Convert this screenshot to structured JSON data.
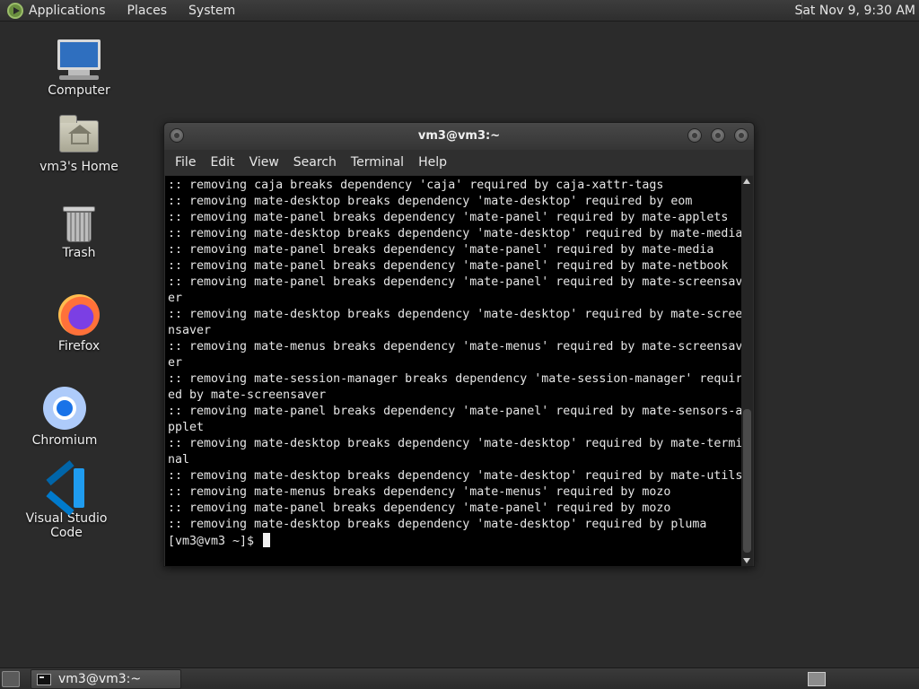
{
  "top_panel": {
    "menus": [
      "Applications",
      "Places",
      "System"
    ],
    "clock": "Sat Nov  9,  9:30 AM"
  },
  "desktop_icons": [
    {
      "label": "Computer",
      "icon": "computer-icon"
    },
    {
      "label": "vm3's Home",
      "icon": "home-folder-icon"
    },
    {
      "label": "Trash",
      "icon": "trash-icon"
    },
    {
      "label": "Firefox",
      "icon": "firefox-icon"
    },
    {
      "label": "Chromium",
      "icon": "chromium-icon"
    },
    {
      "label": "Visual Studio Code",
      "icon": "vscode-icon"
    }
  ],
  "terminal": {
    "title": "vm3@vm3:~",
    "menu": [
      "File",
      "Edit",
      "View",
      "Search",
      "Terminal",
      "Help"
    ],
    "lines": [
      ":: removing caja breaks dependency 'caja' required by caja-xattr-tags",
      ":: removing mate-desktop breaks dependency 'mate-desktop' required by eom",
      ":: removing mate-panel breaks dependency 'mate-panel' required by mate-applets",
      ":: removing mate-desktop breaks dependency 'mate-desktop' required by mate-media",
      ":: removing mate-panel breaks dependency 'mate-panel' required by mate-media",
      ":: removing mate-panel breaks dependency 'mate-panel' required by mate-netbook",
      ":: removing mate-panel breaks dependency 'mate-panel' required by mate-screensav",
      "er",
      ":: removing mate-desktop breaks dependency 'mate-desktop' required by mate-scree",
      "nsaver",
      ":: removing mate-menus breaks dependency 'mate-menus' required by mate-screensav",
      "er",
      ":: removing mate-session-manager breaks dependency 'mate-session-manager' requir",
      "ed by mate-screensaver",
      ":: removing mate-panel breaks dependency 'mate-panel' required by mate-sensors-a",
      "pplet",
      ":: removing mate-desktop breaks dependency 'mate-desktop' required by mate-termi",
      "nal",
      ":: removing mate-desktop breaks dependency 'mate-desktop' required by mate-utils",
      ":: removing mate-menus breaks dependency 'mate-menus' required by mozo",
      ":: removing mate-panel breaks dependency 'mate-panel' required by mozo",
      ":: removing mate-desktop breaks dependency 'mate-desktop' required by pluma"
    ],
    "prompt": "[vm3@vm3 ~]$ "
  },
  "taskbar": {
    "window_label": "vm3@vm3:~"
  }
}
